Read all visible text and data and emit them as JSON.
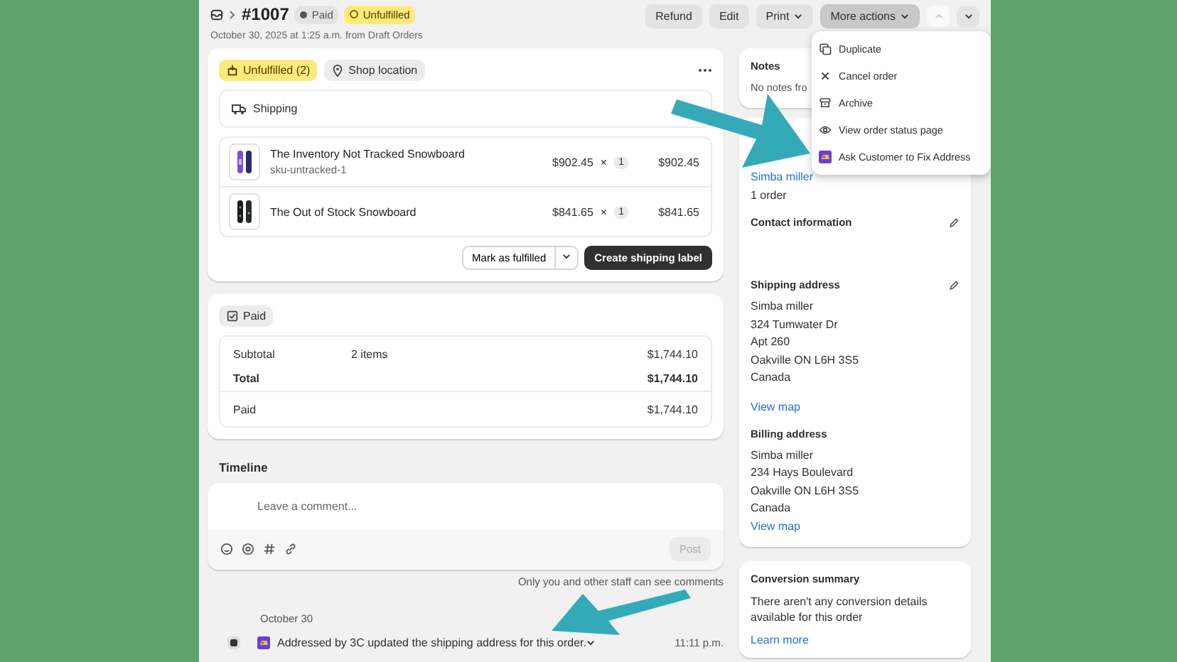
{
  "header": {
    "order_number": "#1007",
    "badges": [
      {
        "label": "Paid",
        "kind": "paid"
      },
      {
        "label": "Unfulfilled",
        "kind": "unfulfilled"
      }
    ],
    "subtitle": "October 30, 2025 at 1:25 a.m. from Draft Orders",
    "actions": [
      {
        "label": "Refund",
        "dropdown": false,
        "pressed": false
      },
      {
        "label": "Edit",
        "dropdown": false,
        "pressed": false
      },
      {
        "label": "Print",
        "dropdown": true,
        "pressed": false
      },
      {
        "label": "More actions",
        "dropdown": true,
        "pressed": true
      }
    ],
    "nav": [
      {
        "disabled": true
      },
      {
        "disabled": false
      }
    ]
  },
  "menu": {
    "items": [
      {
        "label": "Duplicate"
      },
      {
        "label": "Cancel order"
      },
      {
        "label": "Archive"
      },
      {
        "label": "View order status page"
      },
      {
        "label": "Ask Customer to Fix Address"
      }
    ]
  },
  "fulfillment": {
    "status": "Unfulfilled (2)",
    "location": "Shop location",
    "method": "Shipping",
    "items": [
      {
        "name": "The Inventory Not Tracked Snowboard",
        "sku": "sku-untracked-1",
        "price": "$902.45",
        "times": "×",
        "quantity": "1",
        "total": "$902.45",
        "kind": "purple"
      },
      {
        "name": "The Out of Stock Snowboard",
        "price": "$841.65",
        "times": "×",
        "quantity": "1",
        "total": "$841.65",
        "kind": "dark"
      }
    ],
    "secondary_button": "Mark as fulfilled",
    "primary_button": "Create shipping label"
  },
  "payment": {
    "status": "Paid",
    "rows": [
      {
        "label": "Subtotal",
        "detail": "2 items",
        "amount": "$1,744.10",
        "bold": false
      },
      {
        "label": "Total",
        "amount": "$1,744.10",
        "bold": true
      }
    ],
    "paid_row": {
      "label": "Paid",
      "amount": "$1,744.10"
    }
  },
  "timeline": {
    "title": "Timeline",
    "comment": {
      "placeholder": "Leave a comment..."
    },
    "post": "Post",
    "note": "Only you and other staff can see comments",
    "events": [
      {
        "date": "October 30",
        "text": "Addressed by 3C updated the shipping address for this order.",
        "time": "11:11 p.m."
      }
    ]
  },
  "notes": {
    "title": "Notes",
    "text": "No notes fro"
  },
  "customer": {
    "name": "Simba miller",
    "orders": "1 order",
    "contact_title": "Contact information",
    "shipping": {
      "title": "Shipping address",
      "lines": [
        "Simba miller",
        "324 Tumwater Dr",
        "Apt 260",
        "Oakville ON L6H 3S5",
        "Canada"
      ],
      "link": "View map"
    },
    "billing": {
      "title": "Billing address",
      "lines": [
        "Simba miller",
        "234 Hays Boulevard",
        "Oakville ON L6H 3S5",
        "Canada"
      ],
      "link": "View map"
    }
  },
  "conversion": {
    "title": "Conversion summary",
    "text": "There aren't any conversion details available for this order",
    "link": "Learn more"
  }
}
